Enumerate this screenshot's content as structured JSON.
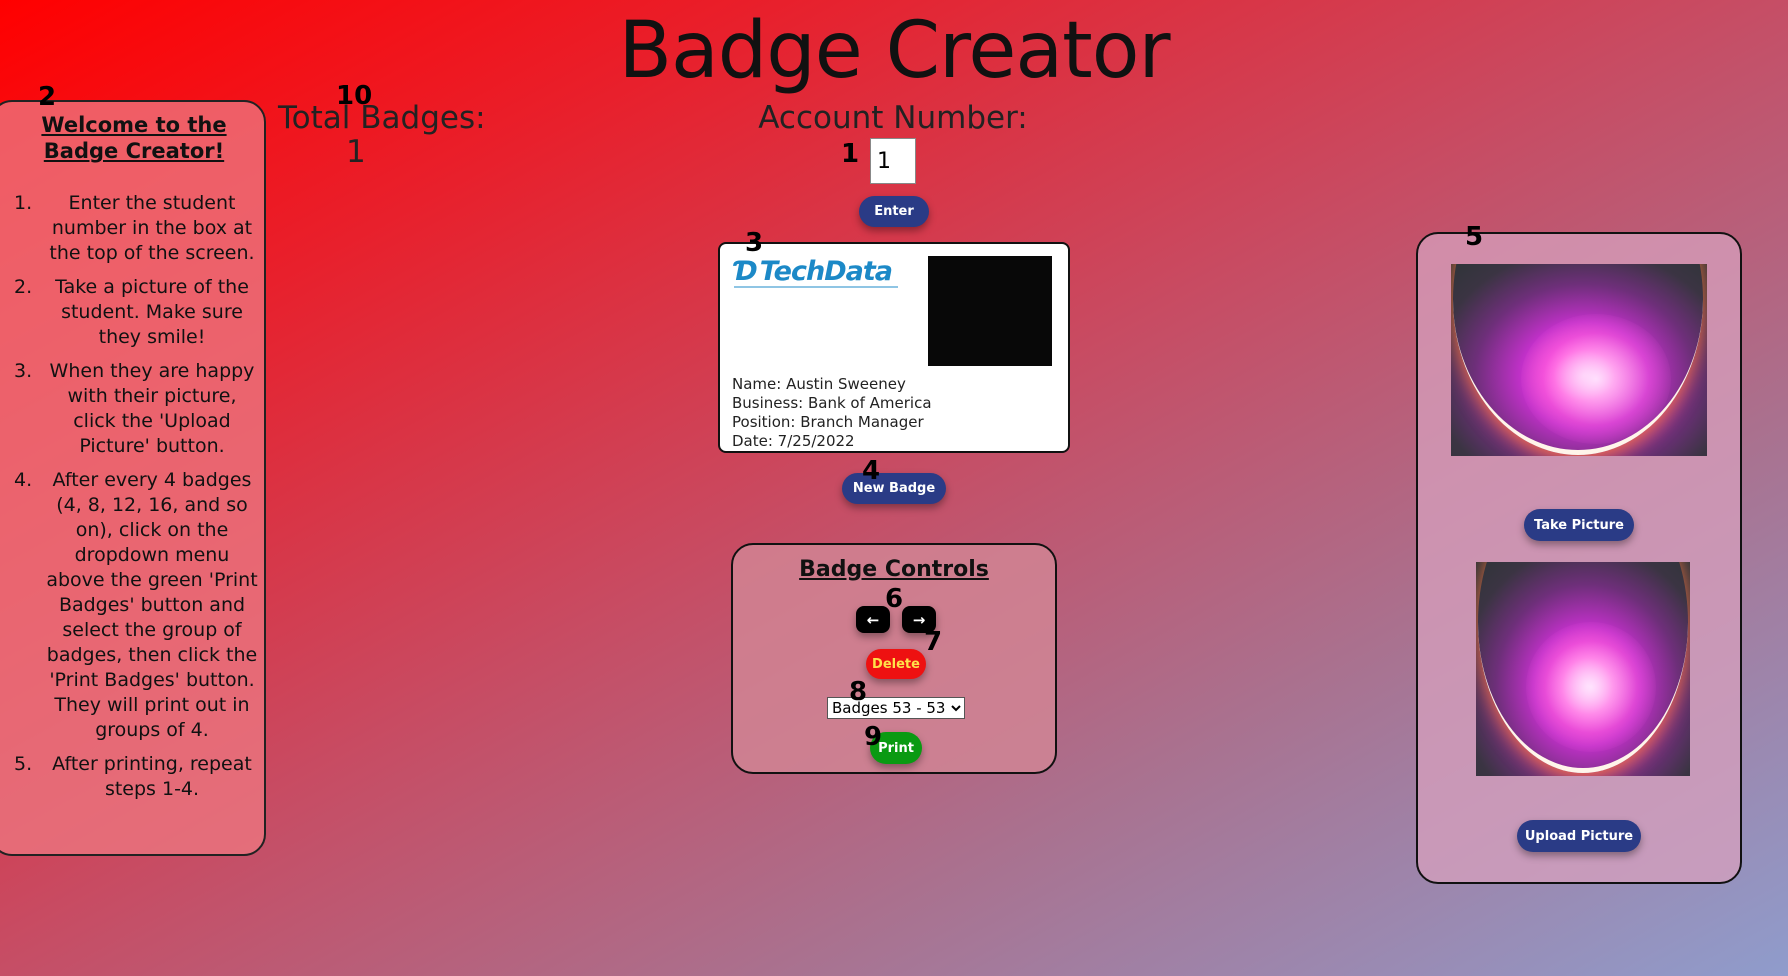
{
  "app": {
    "title": "Badge Creator"
  },
  "markers": {
    "m1": "1",
    "m2": "2",
    "m3": "3",
    "m4": "4",
    "m5": "5",
    "m6": "6",
    "m7": "7",
    "m8": "8",
    "m9": "9",
    "m10": "10"
  },
  "instructions": {
    "heading": "Welcome to the Badge Creator!",
    "steps": [
      {
        "num": "1.",
        "text": "Enter the student number in the box at the top of the screen."
      },
      {
        "num": "2.",
        "text": "Take a picture of the student. Make sure they smile!"
      },
      {
        "num": "3.",
        "text": "When they are happy with their picture, click the 'Upload Picture' button."
      },
      {
        "num": "4.",
        "text": "After every 4 badges (4, 8, 12, 16, and so on), click on the dropdown menu above the green 'Print Badges' button and select the group of badges, then click the 'Print Badges' button. They will print out in groups of 4."
      },
      {
        "num": "5.",
        "text": "After printing, repeat steps 1-4."
      }
    ]
  },
  "totals": {
    "label": "Total Badges:",
    "value": "1"
  },
  "account": {
    "label": "Account Number:",
    "value": "1",
    "enter_label": "Enter"
  },
  "badge": {
    "logo_mark": "Ɗ",
    "logo_text": "TechData",
    "name_line": "Name: Austin Sweeney",
    "business_line": "Business: Bank of America",
    "position_line": "Position: Branch Manager",
    "date_line": "Date: 7/25/2022",
    "new_badge_label": "New Badge"
  },
  "controls": {
    "title": "Badge Controls",
    "prev_label": "←",
    "next_label": "→",
    "delete_label": "Delete",
    "group_selected": "Badges 53 - 53",
    "print_label": "Print"
  },
  "camera": {
    "take_picture_label": "Take Picture",
    "upload_picture_label": "Upload Picture"
  }
}
